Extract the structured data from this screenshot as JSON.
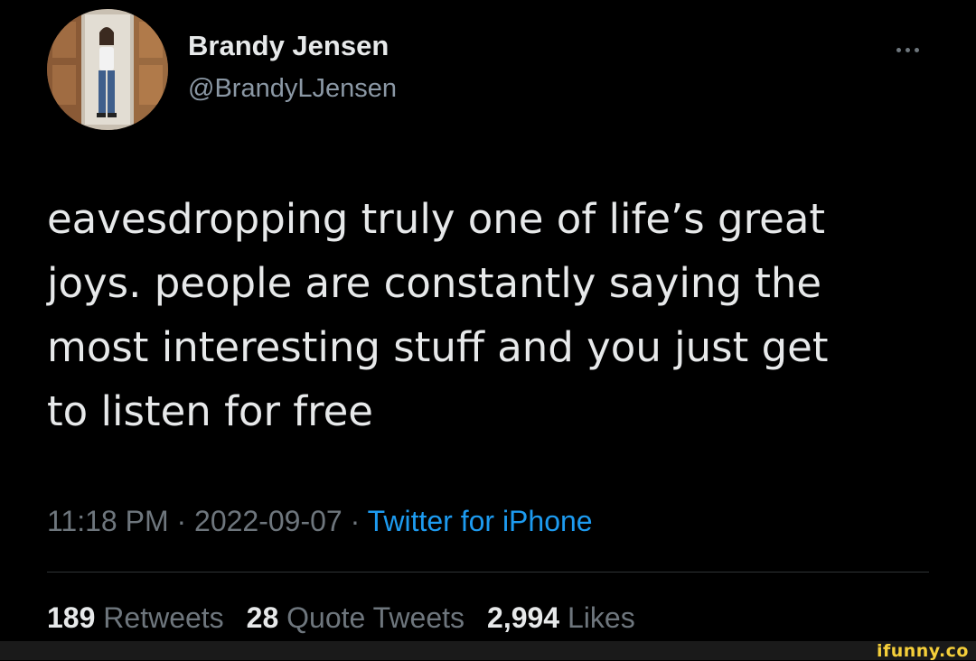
{
  "author": {
    "display_name": "Brandy Jensen",
    "handle": "@BrandyLJensen"
  },
  "more_icon": "more-horizontal-icon",
  "tweet": {
    "lines": [
      "eavesdropping truly one of life’s great",
      "joys. people are constantly saying the",
      "most interesting stuff and you just get",
      "to listen for free"
    ],
    "time": "11:18 PM",
    "separator": "·",
    "date": "2022-09-07",
    "source": "Twitter for iPhone"
  },
  "stats": {
    "retweets": {
      "count": "189",
      "label": "Retweets"
    },
    "quote_tweets": {
      "count": "28",
      "label": "Quote Tweets"
    },
    "likes": {
      "count": "2,994",
      "label": "Likes"
    }
  },
  "watermark": "ifunny.co",
  "colors": {
    "background": "#000000",
    "text_primary": "#e7e9ea",
    "text_secondary": "#6e767d",
    "link": "#1d9bf0",
    "watermark": "#f5cf3a"
  }
}
